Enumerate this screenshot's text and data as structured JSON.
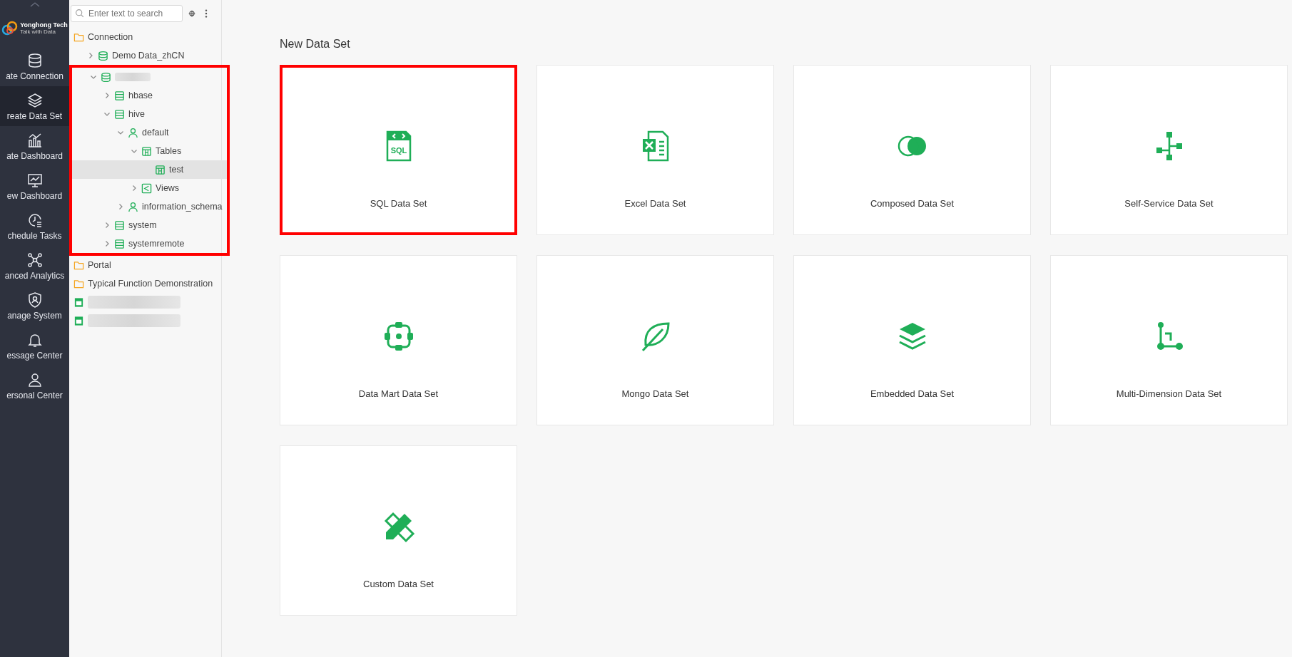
{
  "sidebar": {
    "logo": {
      "name": "Yonghong Tech",
      "tagline": "Talk with Data"
    },
    "items": [
      {
        "label": "ate Connection",
        "selected": false
      },
      {
        "label": "reate Data Set",
        "selected": true
      },
      {
        "label": "ate Dashboard",
        "selected": false
      },
      {
        "label": "ew Dashboard",
        "selected": false
      },
      {
        "label": "chedule Tasks",
        "selected": false
      },
      {
        "label": "anced Analytics",
        "selected": false
      },
      {
        "label": "anage System",
        "selected": false
      },
      {
        "label": "essage Center",
        "selected": false
      },
      {
        "label": "ersonal Center",
        "selected": false
      }
    ]
  },
  "tree": {
    "search": {
      "placeholder": "Enter text to search"
    },
    "nodes": [
      {
        "kind": "folder",
        "label": "Connection",
        "selected": false,
        "children": [
          {
            "kind": "datasource",
            "label": "Demo Data_zhCN",
            "expanded": false,
            "selected": false
          },
          {
            "kind": "datasource",
            "redacted": true,
            "expanded": true,
            "selected": false,
            "highlighted": true,
            "children": [
              {
                "kind": "database",
                "label": "hbase",
                "expanded": false,
                "selected": false
              },
              {
                "kind": "database",
                "label": "hive",
                "expanded": true,
                "selected": false,
                "children": [
                  {
                    "kind": "schema",
                    "label": "default",
                    "expanded": true,
                    "selected": false,
                    "children": [
                      {
                        "kind": "tables",
                        "label": "Tables",
                        "expanded": true,
                        "selected": false,
                        "children": [
                          {
                            "kind": "table",
                            "label": "test",
                            "selected": true
                          }
                        ]
                      },
                      {
                        "kind": "views",
                        "label": "Views",
                        "expanded": false,
                        "selected": false
                      }
                    ]
                  },
                  {
                    "kind": "schema",
                    "label": "information_schema",
                    "expanded": false,
                    "selected": false
                  }
                ]
              },
              {
                "kind": "database",
                "label": "system",
                "expanded": false,
                "selected": false
              },
              {
                "kind": "database",
                "label": "systemremote",
                "expanded": false,
                "selected": false
              }
            ]
          }
        ]
      },
      {
        "kind": "folder",
        "label": "Portal",
        "selected": false
      },
      {
        "kind": "folder",
        "label": "Typical Function Demonstration",
        "selected": false
      },
      {
        "kind": "report",
        "redacted": true,
        "selected": false
      },
      {
        "kind": "report",
        "redacted": true,
        "selected": false
      }
    ]
  },
  "main": {
    "title": "New Data Set",
    "cards": [
      {
        "kind": "sql",
        "label": "SQL Data Set",
        "icon_text": "SQL",
        "highlighted": true
      },
      {
        "kind": "excel",
        "label": "Excel Data Set",
        "highlighted": false
      },
      {
        "kind": "composed",
        "label": "Composed Data Set",
        "highlighted": false
      },
      {
        "kind": "self-service",
        "label": "Self-Service Data Set",
        "highlighted": false
      },
      {
        "kind": "data-mart",
        "label": "Data Mart Data Set",
        "highlighted": false
      },
      {
        "kind": "mongo",
        "label": "Mongo Data Set",
        "highlighted": false
      },
      {
        "kind": "embedded",
        "label": "Embedded Data Set",
        "highlighted": false
      },
      {
        "kind": "multi-dimension",
        "label": "Multi-Dimension Data Set",
        "highlighted": false
      },
      {
        "kind": "custom",
        "label": "Custom Data Set",
        "highlighted": false
      }
    ]
  }
}
